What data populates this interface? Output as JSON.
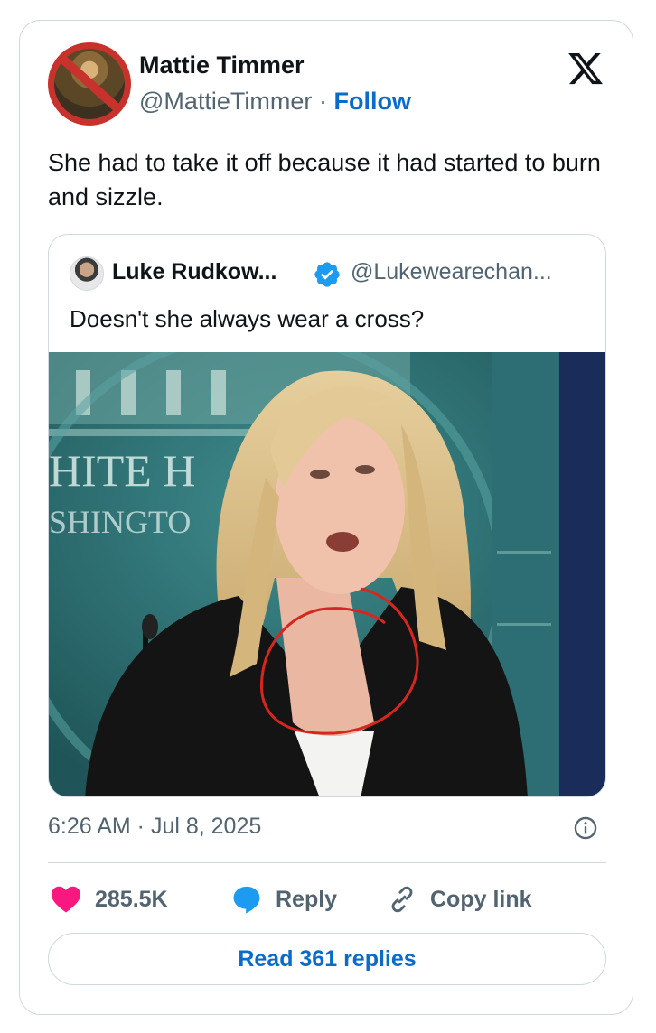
{
  "author": {
    "name": "Mattie Timmer",
    "handle": "@MattieTimmer",
    "separator": "·",
    "follow_label": "Follow"
  },
  "tweet_text": "She had to take it off because it had started to burn and sizzle.",
  "quote": {
    "name": "Luke Rudkow...",
    "handle": "@Lukewearechan...",
    "text": "Doesn't she always wear a cross?",
    "media_caption_lines": [
      "HITE H",
      "SHINGTO"
    ]
  },
  "meta": {
    "timestamp": "6:26 AM · Jul 8, 2025"
  },
  "actions": {
    "like_count": "285.5K",
    "reply_label": "Reply",
    "copy_label": "Copy link"
  },
  "read_replies_label": "Read 361 replies",
  "colors": {
    "link_blue": "#0a6cc8",
    "verified_blue": "#1d9bf0",
    "like_pink": "#f91880",
    "secondary_text": "#536471",
    "border": "#cfd9de"
  },
  "icons": [
    "x-logo-icon",
    "verified-badge-icon",
    "info-icon",
    "heart-icon",
    "reply-bubble-icon",
    "link-icon"
  ]
}
